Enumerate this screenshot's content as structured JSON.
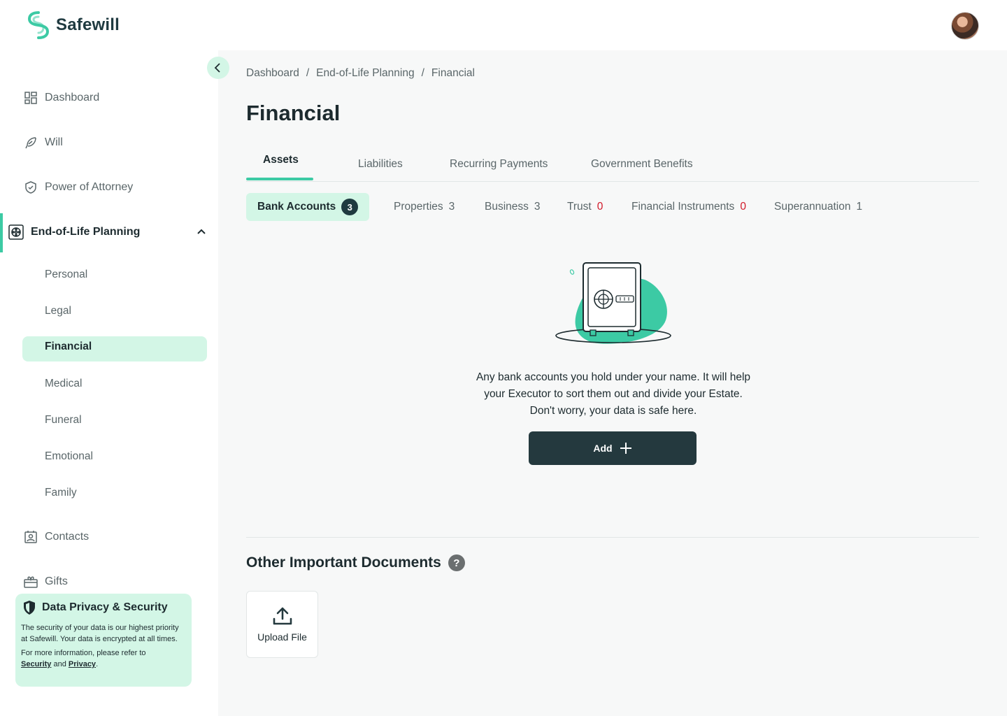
{
  "app": {
    "name": "Safewill",
    "brand_color": "#3ccaa4",
    "dark_color": "#24393e"
  },
  "header": {
    "avatar_icon": "user-avatar"
  },
  "sidebar": {
    "items": [
      {
        "label": "Dashboard",
        "icon": "dashboard-icon"
      },
      {
        "label": "Will",
        "icon": "feather-icon"
      },
      {
        "label": "Power of Attorney",
        "icon": "shield-icon"
      },
      {
        "label": "End-of-Life Planning",
        "icon": "film-reel-icon"
      },
      {
        "label": "Contacts",
        "icon": "contact-card-icon"
      },
      {
        "label": "Gifts",
        "icon": "gift-icon"
      }
    ],
    "subitems": [
      "Personal",
      "Legal",
      "Financial",
      "Medical",
      "Funeral",
      "Emotional",
      "Family"
    ],
    "active_subitem": "Financial",
    "privacy": {
      "title": "Data Privacy & Security",
      "body": "The security of your data is our highest priority at Safewill. Your data is encrypted at all times.",
      "more_prefix": "For more information, please refer to",
      "security_link": "Security",
      "and": "and",
      "privacy_link": "Privacy",
      "period": "."
    }
  },
  "breadcrumb": [
    "Dashboard",
    "End-of-Life Planning",
    "Financial"
  ],
  "breadcrumb_sep": "/",
  "page_title": "Financial",
  "tabs": [
    "Assets",
    "Liabilities",
    "Recurring Payments",
    "Government Benefits"
  ],
  "active_tab": "Assets",
  "subtabs": [
    {
      "label": "Bank Accounts",
      "count": "3"
    },
    {
      "label": "Properties",
      "count": "3"
    },
    {
      "label": "Business",
      "count": "3"
    },
    {
      "label": "Trust",
      "count": "0"
    },
    {
      "label": "Financial Instruments",
      "count": "0"
    },
    {
      "label": "Superannuation",
      "count": "1"
    }
  ],
  "empty_state": {
    "line1": "Any bank accounts you hold under your name. It will help",
    "line2": "your Executor to sort them out and divide your Estate.",
    "line3": "Don't worry, your data is safe here.",
    "add_label": "Add"
  },
  "documents": {
    "title": "Other Important Documents",
    "help": "?",
    "upload_label": "Upload File"
  }
}
